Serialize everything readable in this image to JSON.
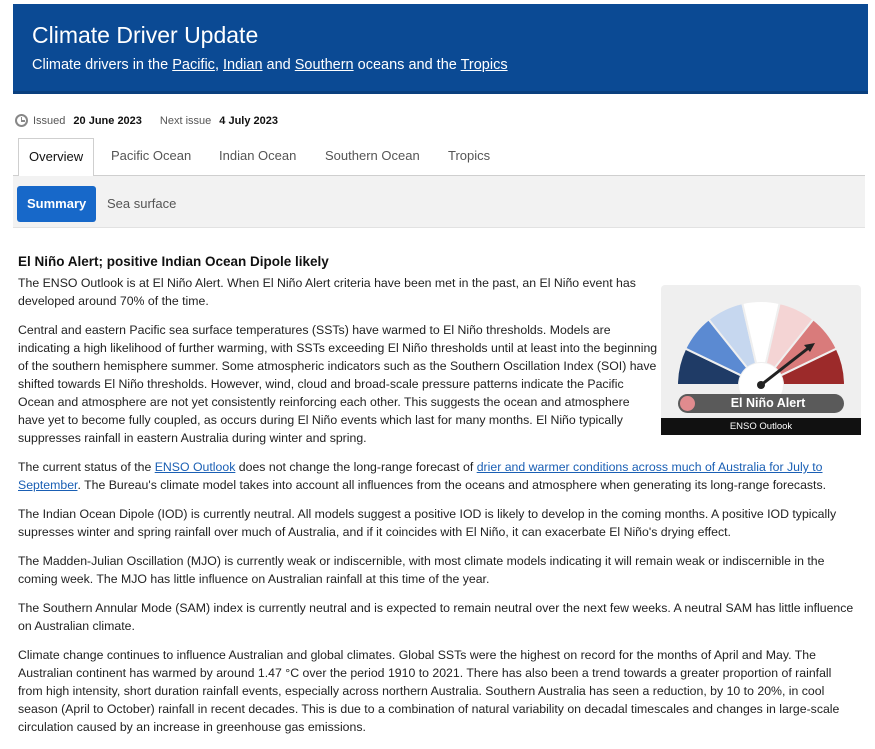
{
  "header": {
    "title": "Climate Driver Update",
    "subtitle_prefix": "Climate drivers in the ",
    "subtitle_links": [
      "Pacific",
      "Indian",
      "Southern",
      "Tropics"
    ],
    "subtitle_joiners": [
      ", ",
      " and ",
      " oceans and the "
    ]
  },
  "issue": {
    "issued_label": "Issued",
    "issued_date": "20 June 2023",
    "next_label": "Next issue",
    "next_date": "4 July 2023"
  },
  "tabs": [
    "Overview",
    "Pacific Ocean",
    "Indian Ocean",
    "Southern Ocean",
    "Tropics"
  ],
  "subtabs": [
    "Summary",
    "Sea surface"
  ],
  "gauge": {
    "status": "El Niño Alert",
    "caption": "ENSO Outlook",
    "colors": [
      "#1f3b66",
      "#5b8ad2",
      "#c6d7ef",
      "#ffffff",
      "#f4d4d4",
      "#d97b7b",
      "#9c2a2a"
    ]
  },
  "content": {
    "heading": "El Niño Alert; positive Indian Ocean Dipole likely",
    "p1": "The ENSO Outlook is at El Niño Alert. When El Niño Alert criteria have been met in the past, an El Niño event has developed around 70% of the time.",
    "p2": "Central and eastern Pacific sea surface temperatures (SSTs) have warmed to El Niño thresholds. Models are indicating a high likelihood of further warming, with SSTs exceeding El Niño thresholds until at least into the beginning of the southern hemisphere summer. Some atmospheric indicators such as the Southern Oscillation Index (SOI) have shifted towards El Niño thresholds. However, wind, cloud and broad-scale pressure patterns indicate the Pacific Ocean and atmosphere are not yet consistently reinforcing each other. This suggests the ocean and atmosphere have yet to become fully coupled, as occurs during El Niño events which last for many months. El Niño typically suppresses rainfall in eastern Australia during winter and spring.",
    "p3_a": "The current status of the ",
    "p3_link1": "ENSO Outlook",
    "p3_b": " does not change the long-range forecast of ",
    "p3_link2": "drier and warmer conditions across much of Australia for July to September",
    "p3_c": ". The Bureau's climate model takes into account all influences from the oceans and atmosphere when generating its long-range forecasts.",
    "p4": "The Indian Ocean Dipole (IOD) is currently neutral. All models suggest a positive IOD is likely to develop in the coming months. A positive IOD typically supresses winter and spring rainfall over much of Australia, and if it coincides with El Niño, it can exacerbate El Niño's drying effect.",
    "p5": "The Madden-Julian Oscillation (MJO) is currently weak or indiscernible, with most climate models indicating it will remain weak or indiscernible in the coming week. The MJO has little influence on Australian rainfall at this time of the year.",
    "p6": "The Southern Annular Mode (SAM) index is currently neutral and is expected to remain neutral over the next few weeks. A neutral SAM has little influence on Australian climate.",
    "p7": "Climate change continues to influence Australian and global climates. Global SSTs were the highest on record for the months of April and May. The Australian continent has warmed by around 1.47 °C over the period 1910 to 2021. There has also been a trend towards a greater proportion of rainfall from high intensity, short duration rainfall events, especially across northern Australia. Southern Australia has seen a reduction, by 10 to 20%, in cool season (April to October) rainfall in recent decades. This is due to a combination of natural variability on decadal timescales and changes in large-scale circulation caused by an increase in greenhouse gas emissions."
  }
}
